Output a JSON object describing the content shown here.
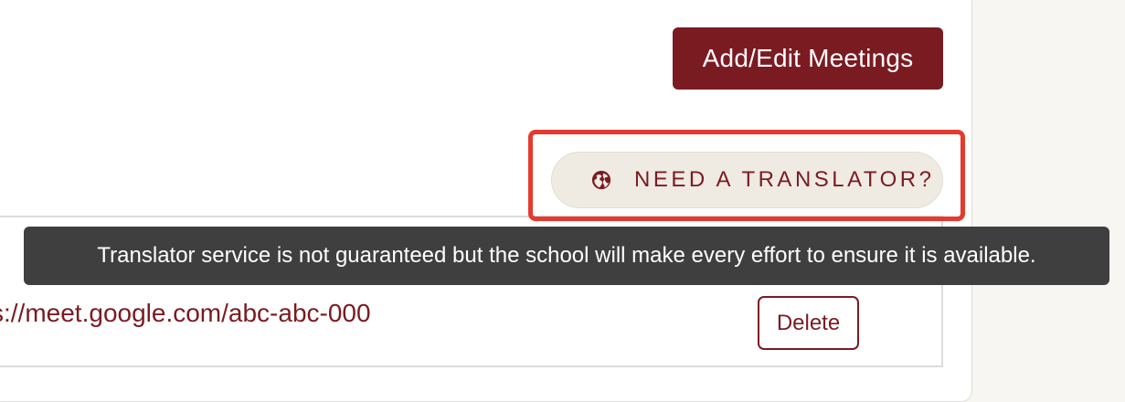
{
  "colors": {
    "accent": "#7a1b22",
    "highlight": "#e53a2f",
    "tooltip_bg": "#3f3f3f",
    "translator_bg": "#efebe3",
    "page_bg": "#f7f6f2"
  },
  "header": {
    "add_edit_meetings_label": "Add/Edit Meetings"
  },
  "translator": {
    "icon": "globe-icon",
    "label": "NEED A TRANSLATOR?",
    "tooltip": "Translator service is not guaranteed but the school will make every effort to ensure it is available."
  },
  "meetings": {
    "link_text": "s://meet.google.com/abc-abc-000",
    "delete_label": "Delete"
  }
}
